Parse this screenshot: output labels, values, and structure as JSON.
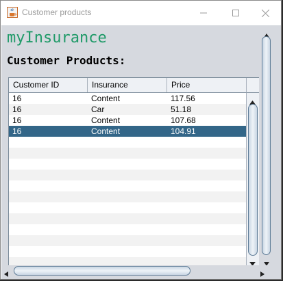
{
  "window": {
    "title": "Customer products",
    "icon": "java-coffee-icon"
  },
  "header": {
    "brand": "myInsurance",
    "subtitle": "Customer Products:",
    "brand_color": "#1f9a68"
  },
  "table": {
    "columns": [
      "Customer ID",
      "Insurance",
      "Price"
    ],
    "rows": [
      {
        "customer_id": "16",
        "insurance": "Content",
        "price": "117.56"
      },
      {
        "customer_id": "16",
        "insurance": "Car",
        "price": "51.18"
      },
      {
        "customer_id": "16",
        "insurance": "Content",
        "price": "107.68"
      },
      {
        "customer_id": "16",
        "insurance": "Content",
        "price": "104.91"
      }
    ],
    "selected_row": 3,
    "selection_color": "#336688"
  }
}
